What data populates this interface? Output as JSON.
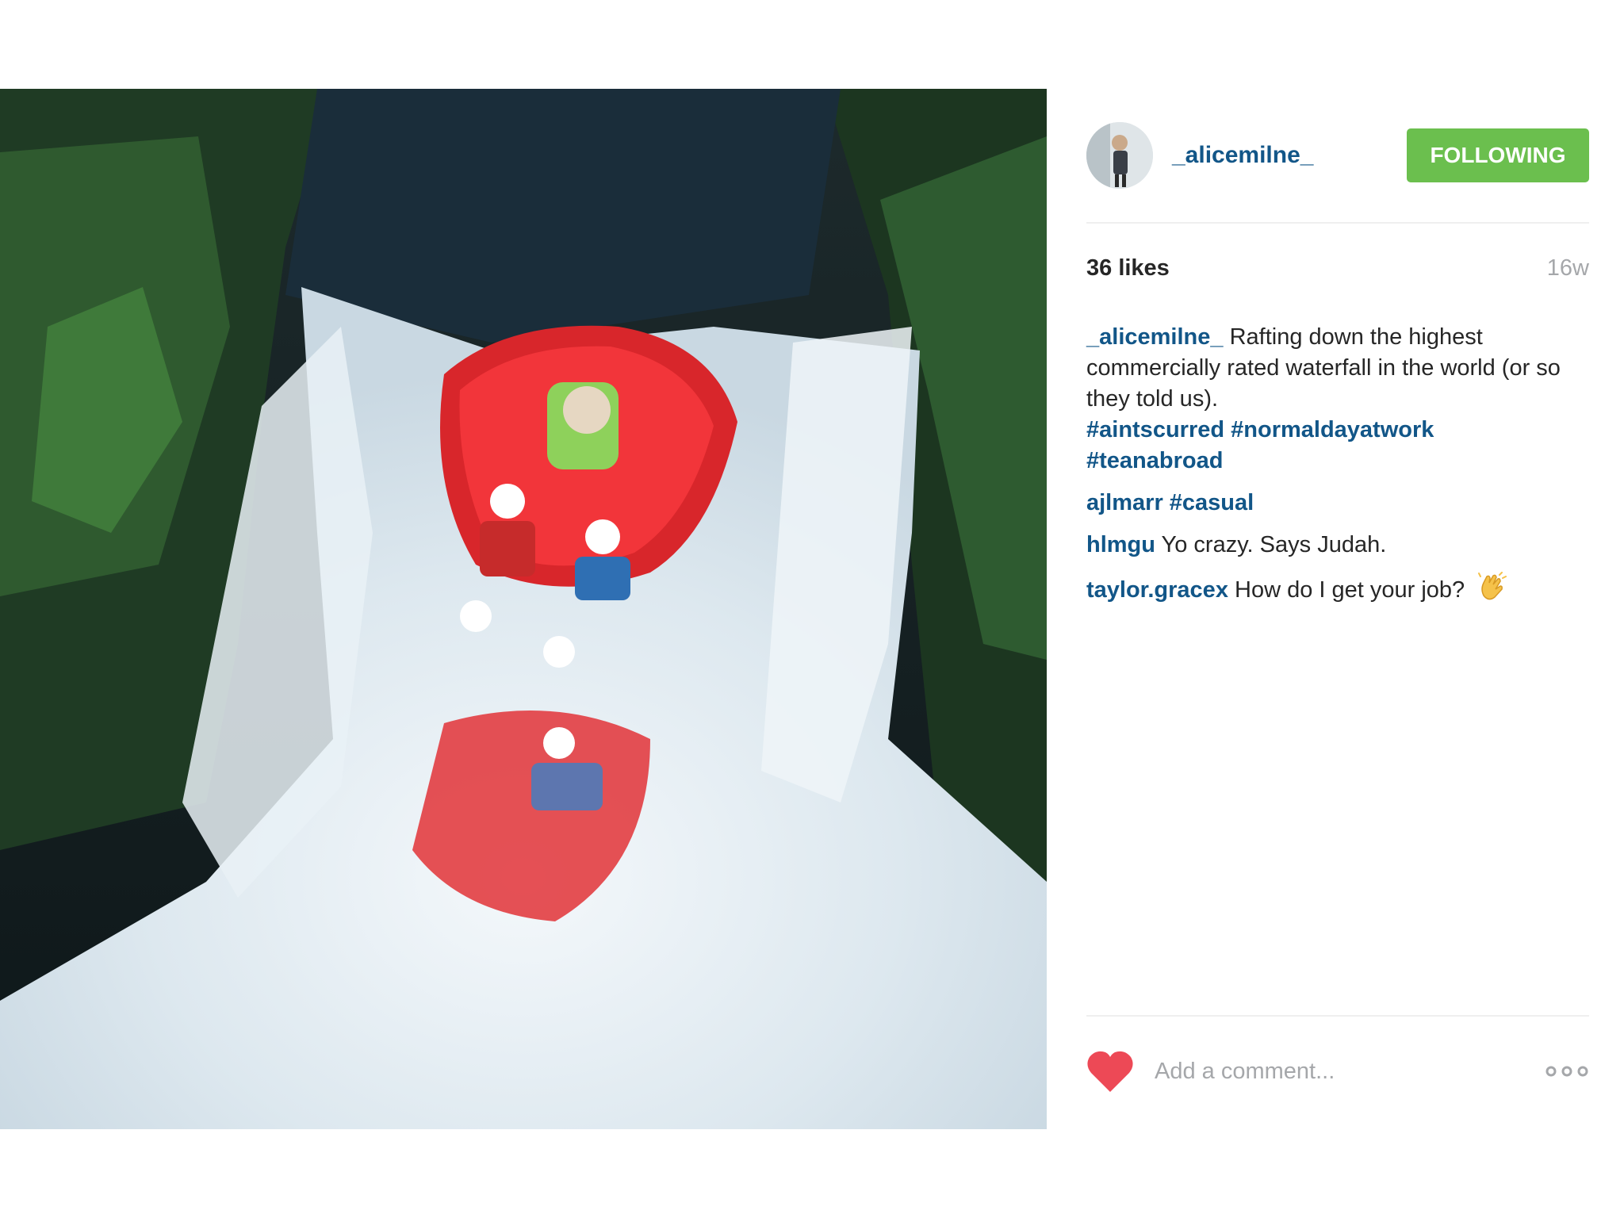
{
  "post": {
    "photo_alt": "photo",
    "author": "_alicemilne_",
    "follow_button": "FOLLOWING",
    "likes": "36 likes",
    "time_ago": "16w",
    "caption": {
      "user": "_alicemilne_",
      "text": "Rafting down the highest commercially rated waterfall in the world (or so they told us).",
      "hashtags": [
        "#aintscurred",
        "#normaldayatwork",
        "#teanabroad"
      ]
    },
    "comments": [
      {
        "user": "ajlmarr",
        "text": "#casual",
        "text_is_tag": true
      },
      {
        "user": "hlmgu",
        "text": "Yo crazy. Says Judah."
      },
      {
        "user": "taylor.gracex",
        "text": "How do I get your job?",
        "emoji": "clapping-hands-icon"
      }
    ],
    "comment_input_placeholder": "Add a comment...",
    "like_icon": "heart-icon",
    "more_icon": "more-options-icon",
    "colors": {
      "username": "#125688",
      "follow_button_bg": "#6bbf4e",
      "heart": "#ed4956",
      "muted": "#a5a7aa"
    }
  }
}
